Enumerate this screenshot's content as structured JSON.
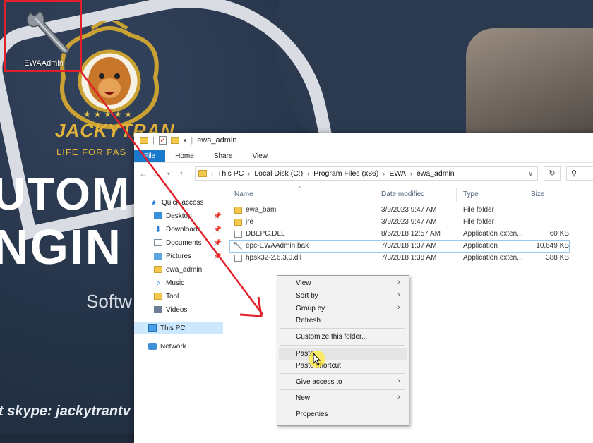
{
  "desktop": {
    "shortcut_label": "EWAAdmin",
    "brand_name": "JACKYTRAN",
    "brand_tagline": "LIFE FOR PAS",
    "banner_line1": "UTOM",
    "banner_line2": "NGIN",
    "banner_line3": "Softw",
    "contact": "t skype: jackytrantv"
  },
  "explorer": {
    "title": "ewa_admin",
    "ribbon_tabs": [
      "File",
      "Home",
      "Share",
      "View"
    ],
    "breadcrumb": [
      "This PC",
      "Local Disk (C:)",
      "Program Files (x86)",
      "EWA",
      "ewa_admin"
    ],
    "search_icon": "search-icon",
    "nav_items": [
      {
        "label": "Quick access",
        "icon": "star-icon",
        "pinned": false
      },
      {
        "label": "Desktop",
        "icon": "desktop-icon",
        "pinned": true
      },
      {
        "label": "Downloads",
        "icon": "download-icon",
        "pinned": true
      },
      {
        "label": "Documents",
        "icon": "documents-icon",
        "pinned": true
      },
      {
        "label": "Pictures",
        "icon": "pictures-icon",
        "pinned": true
      },
      {
        "label": "ewa_admin",
        "icon": "folder-icon",
        "pinned": false
      },
      {
        "label": "Music",
        "icon": "music-icon",
        "pinned": false
      },
      {
        "label": "Tool",
        "icon": "folder-icon",
        "pinned": false
      },
      {
        "label": "Videos",
        "icon": "videos-icon",
        "pinned": false
      },
      {
        "label": "This PC",
        "icon": "pc-icon",
        "pinned": false
      },
      {
        "label": "Network",
        "icon": "network-icon",
        "pinned": false
      }
    ],
    "columns": {
      "name": "Name",
      "date": "Date modified",
      "type": "Type",
      "size": "Size"
    },
    "files": [
      {
        "name": "ewa_bam",
        "date": "3/9/2023 9:47 AM",
        "type": "File folder",
        "size": "",
        "kind": "folder"
      },
      {
        "name": "jre",
        "date": "3/9/2023 9:47 AM",
        "type": "File folder",
        "size": "",
        "kind": "folder"
      },
      {
        "name": "DBEPC.DLL",
        "date": "8/6/2018 12:57 AM",
        "type": "Application exten...",
        "size": "60 KB",
        "kind": "dll"
      },
      {
        "name": "epc-EWAAdmin.bak",
        "date": "7/3/2018 1:37 AM",
        "type": "Application",
        "size": "10,649 KB",
        "kind": "app"
      },
      {
        "name": "hpsk32-2.6.3.0.dll",
        "date": "7/3/2018 1:38 AM",
        "type": "Application exten...",
        "size": "388 KB",
        "kind": "dll"
      }
    ]
  },
  "context_menu": {
    "items": [
      {
        "label": "View",
        "submenu": true
      },
      {
        "label": "Sort by",
        "submenu": true
      },
      {
        "label": "Group by",
        "submenu": true
      },
      {
        "label": "Refresh",
        "submenu": false
      },
      {
        "label": "Customize this folder...",
        "submenu": false
      },
      {
        "label": "Paste",
        "submenu": false
      },
      {
        "label": "Paste shortcut",
        "submenu": false
      },
      {
        "label": "Give access to",
        "submenu": true
      },
      {
        "label": "New",
        "submenu": true
      },
      {
        "label": "Properties",
        "submenu": false
      }
    ]
  },
  "colors": {
    "annotation_red": "#e0202a",
    "ribbon_file": "#1979ca",
    "brand_gold": "#e2b23a"
  }
}
